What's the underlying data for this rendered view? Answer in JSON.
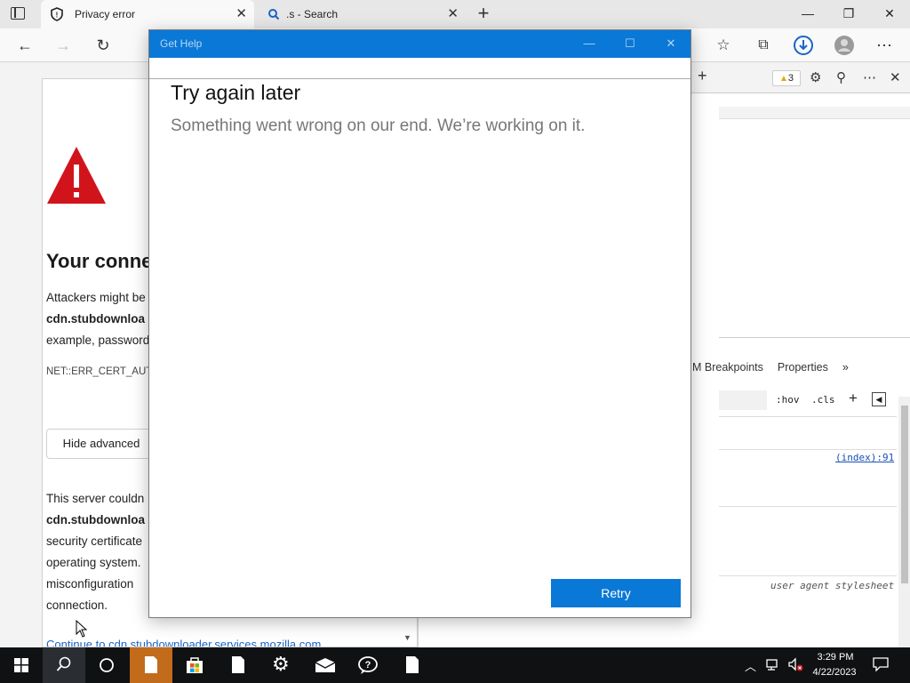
{
  "browser": {
    "tabs": [
      {
        "title": "Privacy error",
        "active": true
      },
      {
        "title": ".s - Search",
        "active": false
      }
    ],
    "warning_count": "3"
  },
  "page": {
    "heading": "Your conne",
    "lines1": [
      "Attackers might be",
      "cdn.stubdownloa",
      "example, password"
    ],
    "error_code": "NET::ERR_CERT_AUT",
    "hide_advanced": "Hide advanced",
    "lines2": [
      "This server couldn",
      "cdn.stubdownloa",
      "security certificate",
      "operating system.",
      "misconfiguration",
      "connection."
    ],
    "continue_link": "Continue to cdn.stubdownloader.services.mozilla.com"
  },
  "devtools": {
    "subtabs": [
      "M Breakpoints",
      "Properties",
      "»"
    ],
    "hov": ":hov",
    "cls": ".cls",
    "index_link": "(index):91",
    "user_agent": "user agent stylesheet"
  },
  "dialog": {
    "title": "Get Help",
    "heading": "Try again later",
    "message": "Something went wrong on our end. We’re working on it.",
    "retry": "Retry"
  },
  "taskbar": {
    "time": "3:29 PM",
    "date": "4/22/2023"
  },
  "colors": {
    "accent": "#0a78d7",
    "warning_red": "#d1141b",
    "taskbar": "#0f1113",
    "active_app": "#c26b1b"
  }
}
